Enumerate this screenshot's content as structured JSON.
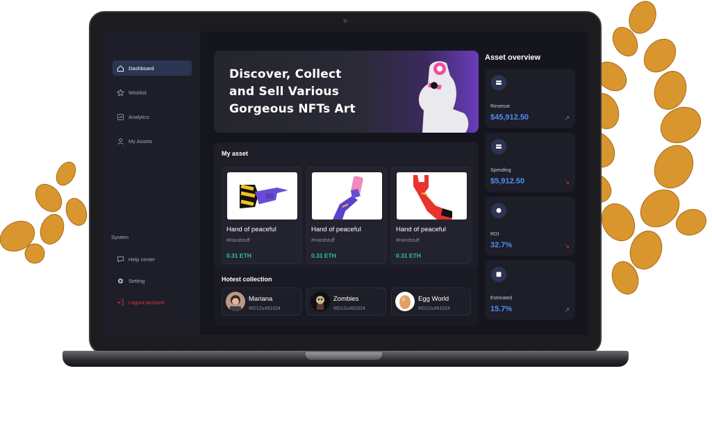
{
  "sidebar": {
    "items": [
      {
        "label": "Dashboard",
        "icon": "home-icon"
      },
      {
        "label": "Wishlist",
        "icon": "star-icon"
      },
      {
        "label": "Analytics",
        "icon": "chart-icon"
      },
      {
        "label": "My Assets",
        "icon": "user-icon"
      }
    ],
    "system_label": "System",
    "system_items": [
      {
        "label": "Help center",
        "icon": "chat-icon"
      },
      {
        "label": "Setting",
        "icon": "gear-icon"
      },
      {
        "label": "Logout account",
        "icon": "logout-icon"
      }
    ]
  },
  "hero": {
    "lines": [
      "Discover, Collect",
      "and Sell Various",
      "Gorgeous NFTs Art"
    ]
  },
  "my_asset": {
    "title": "My asset",
    "cards": [
      {
        "name": "Hand of peaceful",
        "tag": "#Handstuff",
        "price": "0.31 ETH"
      },
      {
        "name": "Hand of peaceful",
        "tag": "#Handstuff",
        "price": "0.31 ETH"
      },
      {
        "name": "Hand of peaceful",
        "tag": "#Handstuff",
        "price": "0.31 ETH"
      }
    ]
  },
  "hotest": {
    "title": "Hotest collection",
    "items": [
      {
        "name": "Mariana",
        "id": "#ID12u491024"
      },
      {
        "name": "Zombies",
        "id": "#ID12u491024"
      },
      {
        "name": "Egg World",
        "id": "#ID12u491024"
      }
    ]
  },
  "overview": {
    "title": "Asset overview",
    "stats": [
      {
        "label": "Revenue",
        "value": "$45,912.50",
        "trend": "up"
      },
      {
        "label": "Spending",
        "value": "$5,912.50",
        "trend": "down"
      },
      {
        "label": "ROI",
        "value": "32.7%",
        "trend": "down"
      },
      {
        "label": "Estimated",
        "value": "15.7%",
        "trend": "up"
      }
    ]
  },
  "colors": {
    "accent": "#4f8ef7",
    "price": "#33c58d",
    "danger": "#e0343f",
    "plant": "#d9962e"
  }
}
